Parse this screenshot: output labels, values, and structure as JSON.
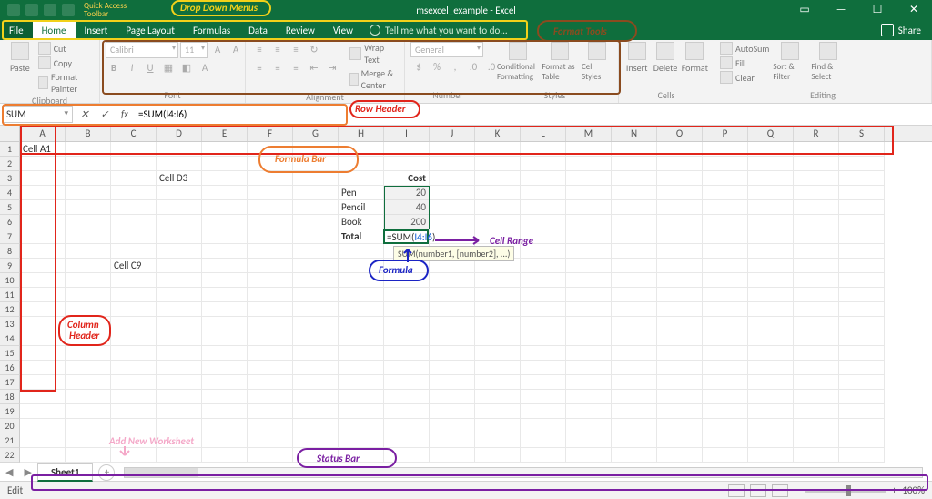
{
  "title": "msexcel_example - Excel",
  "qat_label_l1": "Quick Access",
  "qat_label_l2": "Toolbar",
  "tabs": {
    "file": "File",
    "home": "Home",
    "insert": "Insert",
    "pagelayout": "Page Layout",
    "formulas": "Formulas",
    "data": "Data",
    "review": "Review",
    "view": "View"
  },
  "tellme": "Tell me what you want to do...",
  "share": "Share",
  "ribbon": {
    "clipboard": {
      "label": "Clipboard",
      "paste": "Paste",
      "cut": "Cut",
      "copy": "Copy",
      "painter": "Format Painter"
    },
    "font": {
      "label": "Font",
      "name": "Calibri",
      "size": "11"
    },
    "alignment": {
      "label": "Alignment",
      "wrap": "Wrap Text",
      "merge": "Merge & Center"
    },
    "number": {
      "label": "Number",
      "format": "General"
    },
    "styles": {
      "label": "Styles",
      "cond": "Conditional Formatting",
      "table": "Format as Table",
      "cell": "Cell Styles"
    },
    "cells": {
      "label": "Cells",
      "insert": "Insert",
      "delete": "Delete",
      "format": "Format"
    },
    "editing": {
      "label": "Editing",
      "autosum": "AutoSum",
      "fill": "Fill",
      "clear": "Clear",
      "sort": "Sort & Filter",
      "find": "Find & Select"
    }
  },
  "namebox": "SUM",
  "formula_input": "=SUM(I4:I6)",
  "columns": [
    "A",
    "B",
    "C",
    "D",
    "E",
    "F",
    "G",
    "H",
    "I",
    "J",
    "K",
    "L",
    "M",
    "N",
    "O",
    "P",
    "Q",
    "R",
    "S"
  ],
  "rows": 22,
  "cells": {
    "A1": "Cell A1",
    "D3": "Cell D3",
    "I3": "Cost",
    "H4": "Pen",
    "I4": "20",
    "H5": "Pencil",
    "I5": "40",
    "H6": "Book",
    "I6": "200",
    "H7": "Total",
    "I7": "=SUM(I4:I6)",
    "C9": "Cell C9"
  },
  "tooltip": "SUM(number1, [number2], ...)",
  "sheet": "Sheet1",
  "status_mode": "Edit",
  "zoom_pct": "100%",
  "annotations": {
    "dropdown": "Drop Down Menus",
    "formattools": "Format Tools",
    "rowheader": "Row Header",
    "formulabar": "Formula Bar",
    "columnheader_l1": "Column",
    "columnheader_l2": "Header",
    "formula": "Formula",
    "cellrange": "Cell Range",
    "addnew": "Add New Worksheet",
    "statusbar": "Status Bar"
  }
}
